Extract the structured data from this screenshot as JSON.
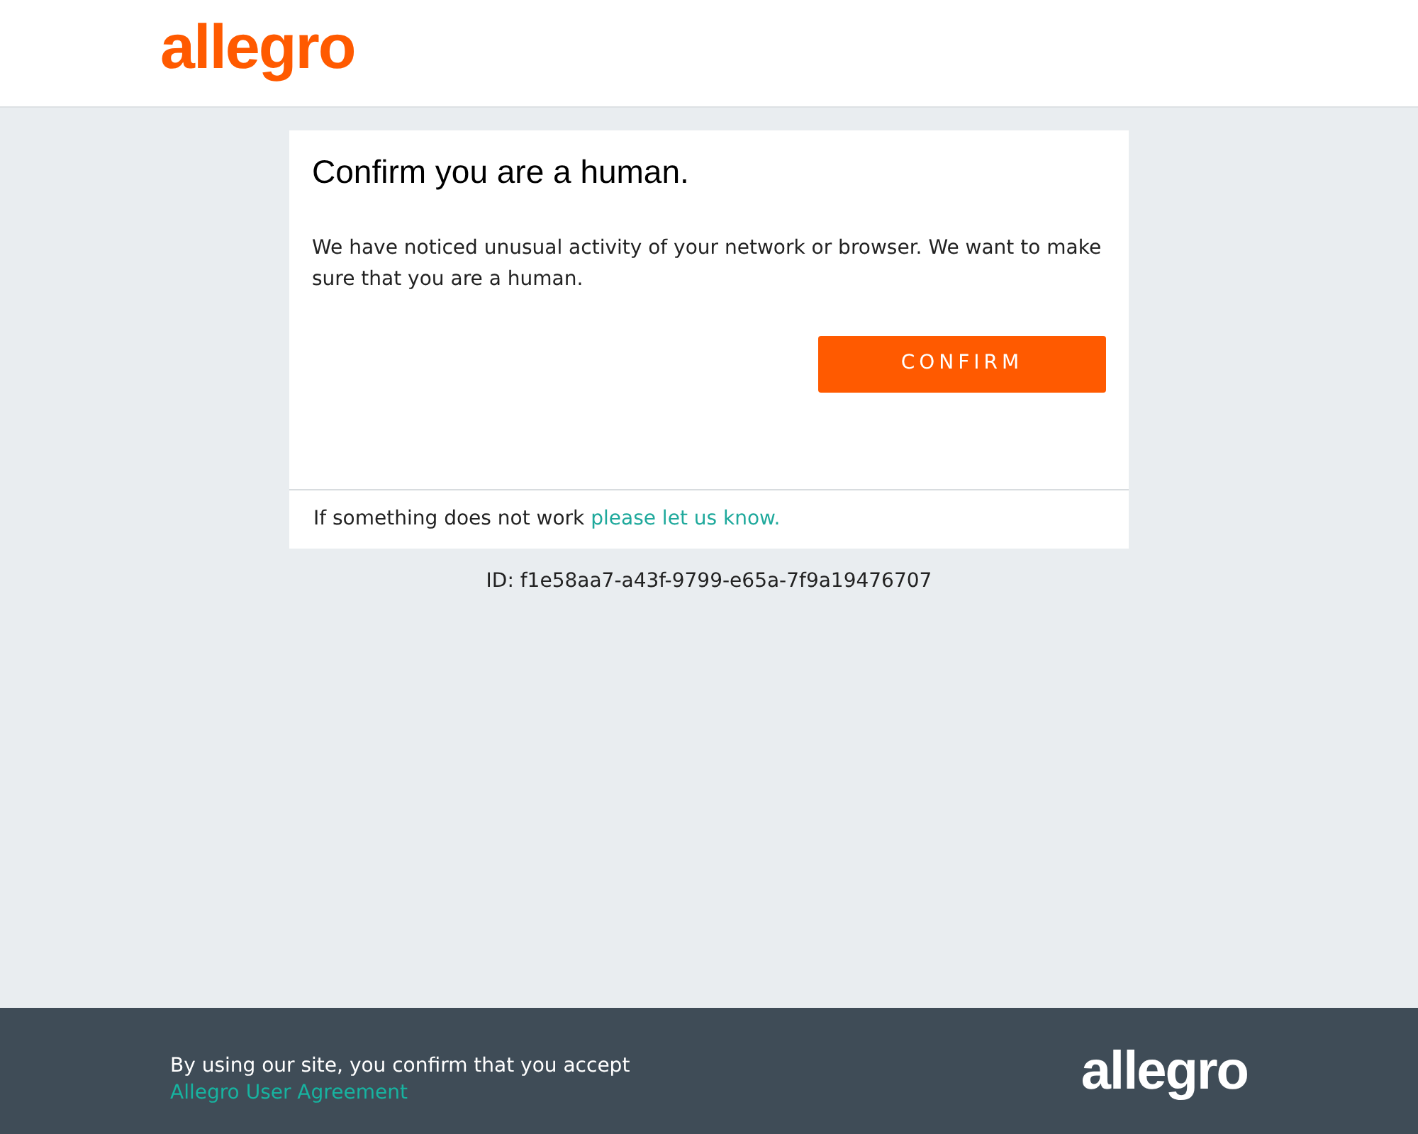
{
  "header": {
    "logo": "allegro"
  },
  "card": {
    "title": "Confirm you are a human.",
    "message": "We have noticed unusual activity of your network or browser. We want to make sure that you are a human.",
    "button": "CONFIRM",
    "help_text": "If something does not work",
    "help_link": "please let us know."
  },
  "request_id": "ID: f1e58aa7-a43f-9799-e65a-7f9a19476707",
  "footer": {
    "text": "By using our site, you confirm that you accept",
    "link": "Allegro User Agreement",
    "logo": "allegro"
  }
}
